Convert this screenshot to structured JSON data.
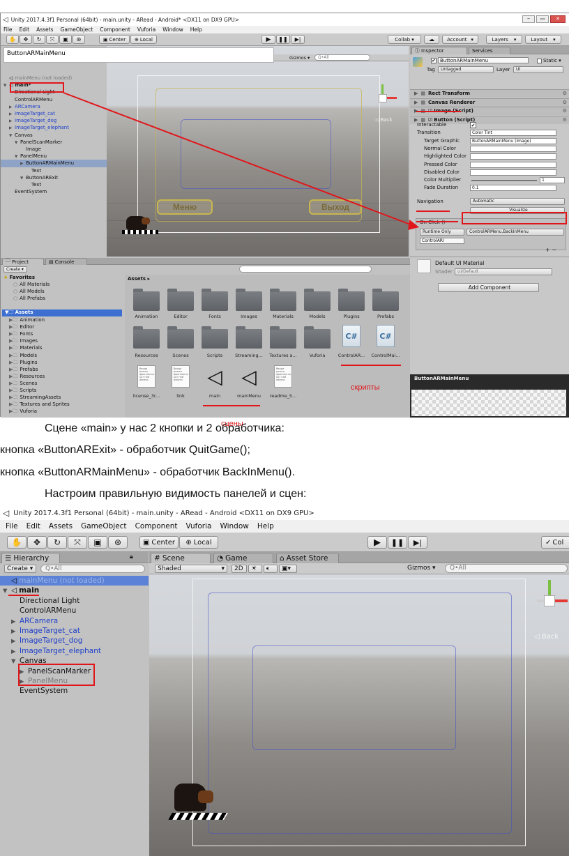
{
  "s1": {
    "title": "Unity 2017.4.3f1 Personal (64bit) - main.unity - ARead - Android* <DX11 on DX9 GPU>",
    "menu": [
      "File",
      "Edit",
      "Assets",
      "GameObject",
      "Component",
      "Vuforia",
      "Window",
      "Help"
    ],
    "center": "Center",
    "local": "Local",
    "collab": "Collab ▾",
    "account": "Account",
    "layers": "Layers",
    "layout": "Layout",
    "search_overlay": "ButtonARMainMenu",
    "gizmos": "Gizmos ▾",
    "search_all": "Q•All",
    "hierarchy": [
      {
        "text": "mainMenu (not loaded)",
        "indent": 0,
        "style": "grey",
        "arrow": "",
        "icon": "unity"
      },
      {
        "text": "main*",
        "indent": 0,
        "style": "bold",
        "arrow": "▼",
        "icon": "unity"
      },
      {
        "text": "Directional Light",
        "indent": 1,
        "style": "",
        "arrow": ""
      },
      {
        "text": "ControlARMenu",
        "indent": 1,
        "style": "",
        "arrow": ""
      },
      {
        "text": "ARCamera",
        "indent": 1,
        "style": "blue",
        "arrow": "▶"
      },
      {
        "text": "ImageTarget_cat",
        "indent": 1,
        "style": "blue",
        "arrow": "▶"
      },
      {
        "text": "ImageTarget_dog",
        "indent": 1,
        "style": "blue",
        "arrow": "▶"
      },
      {
        "text": "ImageTarget_elephant",
        "indent": 1,
        "style": "blue",
        "arrow": "▶"
      },
      {
        "text": "Canvas",
        "indent": 1,
        "style": "",
        "arrow": "▼"
      },
      {
        "text": "PanelScanMarker",
        "indent": 2,
        "style": "",
        "arrow": "▼"
      },
      {
        "text": "Image",
        "indent": 3,
        "style": "",
        "arrow": ""
      },
      {
        "text": "PanelMenu",
        "indent": 2,
        "style": "",
        "arrow": "▼"
      },
      {
        "text": "ButtonARMainMenu",
        "indent": 3,
        "style": "sel",
        "arrow": "▶"
      },
      {
        "text": "Text",
        "indent": 4,
        "style": "",
        "arrow": ""
      },
      {
        "text": "ButtonARExit",
        "indent": 3,
        "style": "",
        "arrow": "▼"
      },
      {
        "text": "Text",
        "indent": 4,
        "style": "",
        "arrow": ""
      },
      {
        "text": "EventSystem",
        "indent": 1,
        "style": "",
        "arrow": ""
      }
    ],
    "scene_btn_menu": "Меню",
    "scene_btn_exit": "Выход",
    "back": "◁ Back",
    "inspector_tab": "Inspector",
    "services_tab": "Services",
    "obj_name": "ButtonARMainMenu",
    "static": "Static ▾",
    "tag_label": "Tag",
    "tag_value": "Untagged",
    "layer_label": "Layer",
    "layer_value": "UI",
    "components": [
      "Rect Transform",
      "Canvas Renderer",
      "Image (Script)",
      "Button (Script)"
    ],
    "props": [
      {
        "label": "Interactable",
        "value": "✔"
      },
      {
        "label": "Transition",
        "value": "Color Tint"
      },
      {
        "label": "Target Graphic",
        "value": "ButtonARMainMenu (Image)"
      },
      {
        "label": "Normal Color",
        "value": ""
      },
      {
        "label": "Highlighted Color",
        "value": ""
      },
      {
        "label": "Pressed Color",
        "value": ""
      },
      {
        "label": "Disabled Color",
        "value": ""
      },
      {
        "label": "Color Multiplier",
        "value": "1"
      },
      {
        "label": "Fade Duration",
        "value": "0.1"
      }
    ],
    "navigation_label": "Navigation",
    "navigation_value": "Automatic",
    "visualize": "Visualize",
    "onclick": "On Click ()",
    "runtime": "Runtime Only",
    "handler": "ControlARMenu.BackInMenu",
    "object_ref": "ControlARI",
    "plus_minus": "+  −",
    "material": "Default UI Material",
    "shader_label": "Shader",
    "shader_value": "UI/Default",
    "add_component": "Add Component",
    "preview_title": "ButtonARMainMenu",
    "project_tab": "Project",
    "console_tab": "Console",
    "create": "Create ▾",
    "favorites": "Favorites",
    "fav_items": [
      "All Materials",
      "All Models",
      "All Prefabs"
    ],
    "assets_root": "Assets",
    "asset_tree": [
      "Animation",
      "Editor",
      "Fonts",
      "Images",
      "Materials",
      "Models",
      "Plugins",
      "Prefabs",
      "Resources",
      "Scenes",
      "Scripts",
      "StreamingAssets",
      "Textures and Sprites",
      "Vuforia"
    ],
    "assets_crumb": "Assets ▸",
    "folders_row1": [
      "Animation",
      "Editor",
      "Fonts",
      "Images",
      "Materials",
      "Models",
      "Plugins",
      "Prefabs"
    ],
    "folders_row2": [
      "Resources",
      "Scenes",
      "Scripts",
      "Streaming...",
      "Textures a...",
      "Vuforia"
    ],
    "scripts": [
      "ControlAR...",
      "ControlMai..."
    ],
    "files_row3": [
      "license_3r...",
      "link",
      "main",
      "mainMenu",
      "readme_S..."
    ],
    "doc_text": "Вводи рожки фрагменты кот ней debens",
    "label_scripts": "скрипты",
    "label_scenes": "сцены"
  },
  "text": {
    "p1": "Сцене «main» у нас 2 кнопки и 2 обработчика:",
    "p2": "кнопка «ButtonARExit» - обработчик QuitGame();",
    "p3": "кнопка «ButtonARMainMenu» - обработчик BackInMenu().",
    "p4": "Настроим правильную видимость панелей и сцен:"
  },
  "s2": {
    "title": "Unity 2017.4.3f1 Personal (64bit) - main.unity - ARead - Android <DX11 on DX9 GPU>",
    "menu": [
      "File",
      "Edit",
      "Assets",
      "GameObject",
      "Component",
      "Vuforia",
      "Window",
      "Help"
    ],
    "center": "Center",
    "local": "Local",
    "collab": "Col",
    "hierarchy_tab": "Hierarchy",
    "create": "Create ▾",
    "search": "Q•All",
    "scene_tab": "Scene",
    "game_tab": "Game",
    "store_tab": "Asset Store",
    "shaded": "Shaded",
    "mode2d": "2D",
    "gizmos": "Gizmos ▾",
    "search_all": "Q•All",
    "back": "◁ Back",
    "hierarchy": [
      {
        "text": "mainMenu (not loaded)",
        "indent": 0,
        "style": "selgrey",
        "arrow": "",
        "icon": "unity"
      },
      {
        "text": "main",
        "indent": 0,
        "style": "bold",
        "arrow": "▼",
        "icon": "unity"
      },
      {
        "text": "Directional Light",
        "indent": 1,
        "style": "",
        "arrow": ""
      },
      {
        "text": "ControlARMenu",
        "indent": 1,
        "style": "",
        "arrow": ""
      },
      {
        "text": "ARCamera",
        "indent": 1,
        "style": "blue",
        "arrow": "▶"
      },
      {
        "text": "ImageTarget_cat",
        "indent": 1,
        "style": "blue",
        "arrow": "▶"
      },
      {
        "text": "ImageTarget_dog",
        "indent": 1,
        "style": "blue",
        "arrow": "▶"
      },
      {
        "text": "ImageTarget_elephant",
        "indent": 1,
        "style": "blue",
        "arrow": "▶"
      },
      {
        "text": "Canvas",
        "indent": 1,
        "style": "",
        "arrow": "▼"
      },
      {
        "text": "PanelScanMarker",
        "indent": 2,
        "style": "",
        "arrow": "▶"
      },
      {
        "text": "PanelMenu",
        "indent": 2,
        "style": "grey",
        "arrow": "▶"
      },
      {
        "text": "EventSystem",
        "indent": 1,
        "style": "",
        "arrow": ""
      }
    ]
  }
}
